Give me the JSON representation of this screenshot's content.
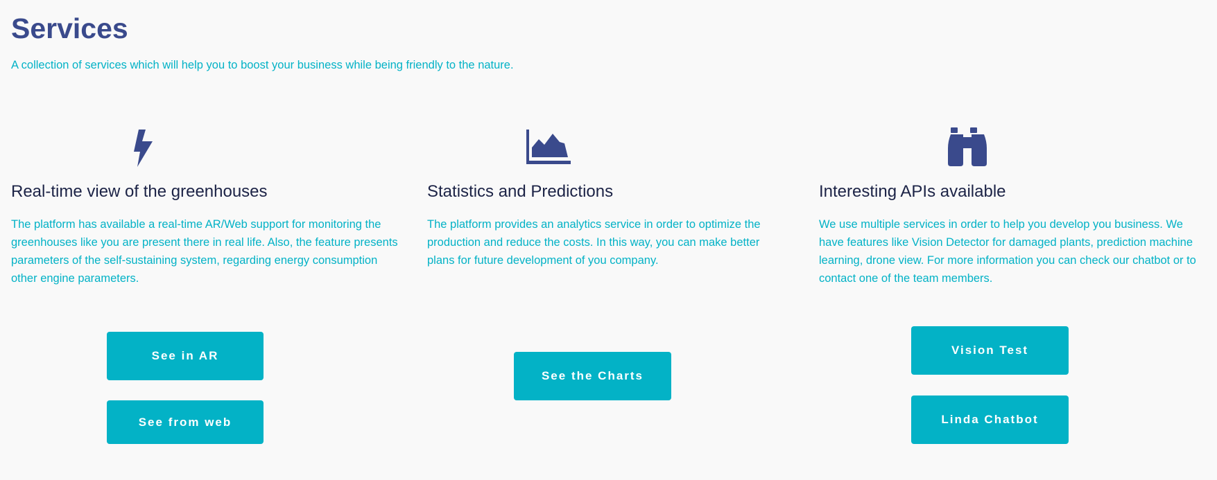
{
  "header": {
    "title": "Services",
    "subtitle": "A collection of services which will help you to boost your business while being friendly to the nature."
  },
  "colors": {
    "background": "#f9f9f9",
    "title": "#3a4a8c",
    "accent": "#03b2c6",
    "heading": "#1c2346",
    "button_text": "#ffffff"
  },
  "services": [
    {
      "icon": "lightning-bolt-icon",
      "title": "Real-time view of the greenhouses",
      "text": "The platform has available a real-time AR/Web support for monitoring the greenhouses like you are present there in real life. Also, the feature presents parameters of the self-sustaining system, regarding energy consumption other engine parameters.",
      "buttons": [
        "See in AR",
        "See from web"
      ]
    },
    {
      "icon": "area-chart-icon",
      "title": "Statistics and Predictions",
      "text": "The platform provides an analytics service in order to optimize the production and reduce the costs. In this way, you can make better plans for future development of you company.",
      "buttons": [
        "See the Charts"
      ]
    },
    {
      "icon": "binoculars-icon",
      "title": "Interesting APIs available",
      "text": "We use multiple services in order to help you develop you business. We have features like Vision Detector for damaged plants, prediction machine learning, drone view. For more information you can check our chatbot or to contact one of the team members.",
      "buttons": [
        "Vision Test",
        "Linda Chatbot"
      ]
    }
  ]
}
